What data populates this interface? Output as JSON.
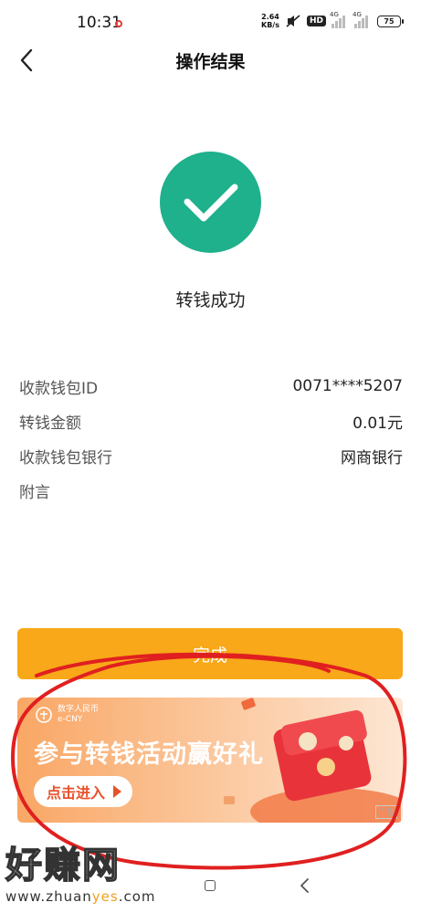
{
  "status": {
    "time": "10:31",
    "speed_value": "2.64",
    "speed_unit": "KB/s",
    "hd": "HD",
    "net1": "4G",
    "net2": "4G",
    "battery": "75"
  },
  "header": {
    "title": "操作结果"
  },
  "result": {
    "text": "转钱成功",
    "color": "#1fb08c"
  },
  "details": [
    {
      "label": "收款钱包ID",
      "value": "0071****5207"
    },
    {
      "label": "转钱金额",
      "value": "0.01元"
    },
    {
      "label": "收款钱包银行",
      "value": "网商银行"
    },
    {
      "label": "附言",
      "value": ""
    }
  ],
  "done_button": {
    "label": "完成",
    "color": "#f8a818"
  },
  "banner": {
    "logo_cn": "数字人民币",
    "logo_en": "e-CNY",
    "title": "参与转钱活动赢好礼",
    "cta": "点击进入",
    "ad_tag": "广告"
  },
  "watermark": {
    "logo": "好赚网",
    "url_prefix": "www.zhuan",
    "url_highlight": "yes",
    "url_suffix": ".com"
  }
}
